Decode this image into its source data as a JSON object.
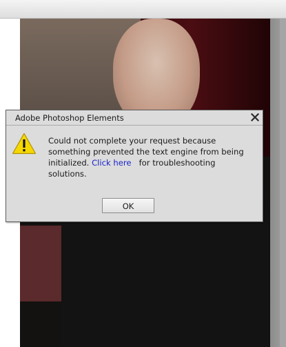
{
  "dialog": {
    "title": "Adobe Photoshop Elements",
    "close_icon": "close-icon",
    "warning_icon": "warning-icon",
    "message": {
      "line1": "Could not complete your request because",
      "line2": "something prevented the text engine from being",
      "line3_before_link": "initialized.",
      "link_text": "Click here",
      "line3_after_link": "for troubleshooting",
      "line4": "solutions."
    },
    "ok_label": "OK"
  },
  "colors": {
    "dialog_bg": "#dcdcdc",
    "link": "#1a24c8",
    "warning_yellow": "#f5d800"
  }
}
